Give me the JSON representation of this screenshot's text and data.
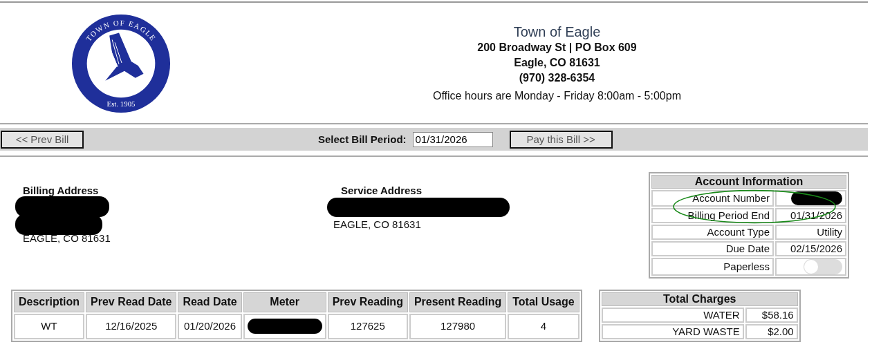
{
  "logo": {
    "ring_text": "TOWN OF EAGLE",
    "est": "Est. 1905"
  },
  "header": {
    "town": "Town of Eagle",
    "lines": [
      "200 Broadway St | PO Box 609",
      "Eagle, CO 81631",
      "(970) 328-6354"
    ],
    "hours": "Office hours are Monday - Friday 8:00am - 5:00pm"
  },
  "nav": {
    "prev_button": "<< Prev Bill",
    "period_label": "Select Bill Period:",
    "period_value": "01/31/2026",
    "pay_button": "Pay this Bill >>"
  },
  "billing_address": {
    "heading": "Billing Address",
    "city_line": "EAGLE, CO 81631"
  },
  "service_address": {
    "heading": "Service Address",
    "city_line": "EAGLE, CO 81631"
  },
  "account_info": {
    "title": "Account Information",
    "rows": [
      {
        "label": "Account Number",
        "kind": "redacted"
      },
      {
        "label": "Billing Period End",
        "kind": "text",
        "value": "01/31/2026"
      },
      {
        "label": "Account Type",
        "kind": "text",
        "value": "Utility"
      },
      {
        "label": "Due Date",
        "kind": "text",
        "value": "02/15/2026"
      },
      {
        "label": "Paperless",
        "kind": "toggle",
        "on": false
      }
    ]
  },
  "usage_table": {
    "columns": [
      "Description",
      "Prev Read Date",
      "Read Date",
      "Meter",
      "Prev Reading",
      "Present Reading",
      "Total Usage"
    ],
    "rows": [
      {
        "cells": [
          {
            "kind": "text",
            "text": "WT"
          },
          {
            "kind": "text",
            "text": "12/16/2025"
          },
          {
            "kind": "text",
            "text": "01/20/2026"
          },
          {
            "kind": "redacted"
          },
          {
            "kind": "text",
            "text": "127625"
          },
          {
            "kind": "text",
            "text": "127980"
          },
          {
            "kind": "text",
            "text": "4"
          }
        ]
      }
    ]
  },
  "charges": {
    "title": "Total Charges",
    "rows": [
      {
        "label": "WATER",
        "amount": "$58.16"
      },
      {
        "label": "YARD WASTE",
        "amount": "$2.00"
      }
    ]
  }
}
